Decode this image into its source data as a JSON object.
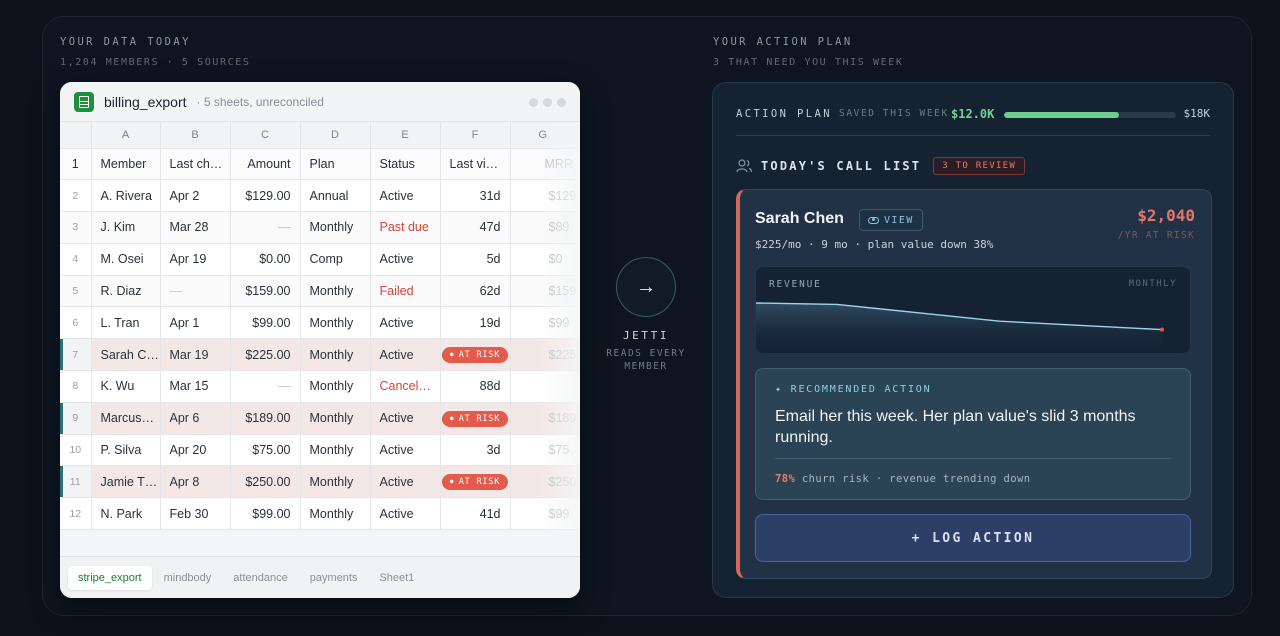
{
  "left_header": {
    "eyebrow": "YOUR DATA TODAY",
    "sub": "1,204 MEMBERS · 5 SOURCES"
  },
  "sheet": {
    "title": "billing_export",
    "subtitle": "· 5 sheets, unreconciled",
    "column_letters": [
      "A",
      "B",
      "C",
      "D",
      "E",
      "F",
      "G"
    ],
    "headers": [
      "Member",
      "Last ch…",
      "Amount",
      "Plan",
      "Status",
      "Last vi…",
      "MRR"
    ],
    "rows": [
      {
        "n": "2",
        "member": "A. Rivera",
        "last": "Apr 2",
        "amount": "$129.00",
        "plan": "Annual",
        "status": "Active",
        "visit": "31d",
        "mrr": "$129"
      },
      {
        "n": "3",
        "member": "J. Kim",
        "last": "Mar 28",
        "amount": "—",
        "plan": "Monthly",
        "status": "Past due",
        "visit": "47d",
        "mrr": "$89"
      },
      {
        "n": "4",
        "member": "M. Osei",
        "last": "Apr 19",
        "amount": "$0.00",
        "plan": "Comp",
        "status": "Active",
        "visit": "5d",
        "mrr": "$0"
      },
      {
        "n": "5",
        "member": "R. Diaz",
        "last": "—",
        "amount": "$159.00",
        "plan": "Monthly",
        "status": "Failed",
        "visit": "62d",
        "mrr": "$159"
      },
      {
        "n": "6",
        "member": "L. Tran",
        "last": "Apr 1",
        "amount": "$99.00",
        "plan": "Monthly",
        "status": "Active",
        "visit": "19d",
        "mrr": "$99"
      },
      {
        "n": "7",
        "member": "Sarah C…",
        "last": "Mar 19",
        "amount": "$225.00",
        "plan": "Monthly",
        "status": "Active",
        "visit": "AT RISK",
        "mrr": "$225"
      },
      {
        "n": "8",
        "member": "K. Wu",
        "last": "Mar 15",
        "amount": "—",
        "plan": "Monthly",
        "status": "Cancel…",
        "visit": "88d",
        "mrr": ""
      },
      {
        "n": "9",
        "member": "Marcus…",
        "last": "Apr 6",
        "amount": "$189.00",
        "plan": "Monthly",
        "status": "Active",
        "visit": "AT RISK",
        "mrr": "$189"
      },
      {
        "n": "10",
        "member": "P. Silva",
        "last": "Apr 20",
        "amount": "$75.00",
        "plan": "Monthly",
        "status": "Active",
        "visit": "3d",
        "mrr": "$75"
      },
      {
        "n": "11",
        "member": "Jamie T…",
        "last": "Apr 8",
        "amount": "$250.00",
        "plan": "Monthly",
        "status": "Active",
        "visit": "AT RISK",
        "mrr": "$250"
      },
      {
        "n": "12",
        "member": "N. Park",
        "last": "Feb 30",
        "amount": "$99.00",
        "plan": "Monthly",
        "status": "Active",
        "visit": "41d",
        "mrr": "$99"
      }
    ],
    "tabs": [
      "stripe_export",
      "mindbody",
      "attendance",
      "payments",
      "Sheet1"
    ]
  },
  "middle": {
    "arrow": "→",
    "name": "JETTI",
    "sub_line1": "READS EVERY",
    "sub_line2": "MEMBER"
  },
  "right_header": {
    "eyebrow": "YOUR ACTION PLAN",
    "sub": "3 THAT NEED YOU THIS WEEK"
  },
  "plan": {
    "label": "ACTION PLAN",
    "saved_label": "SAVED THIS WEEK",
    "saved_value": "$12.0K",
    "goal": "$18K",
    "progress_fraction": 0.667,
    "calls_title": "TODAY'S CALL LIST",
    "review_badge": "3 TO REVIEW",
    "card": {
      "name": "Sarah Chen",
      "view": "VIEW",
      "meta": "$225/mo · 9 mo · plan value down 38%",
      "risk_amount": "$2,040",
      "risk_label": "/YR AT RISK",
      "chart_label": "REVENUE",
      "chart_freq": "MONTHLY",
      "rec_label": "✦ RECOMMENDED ACTION",
      "rec_text": "Email her this week. Her plan value's slid 3 months running.",
      "churn_pct": "78%",
      "churn_text": "churn risk · revenue trending down",
      "log_action": "+ LOG ACTION"
    }
  },
  "chart_data": {
    "type": "area",
    "title": "",
    "xlabel": "",
    "ylabel": "REVENUE",
    "series": [
      {
        "values": [
          100,
          98,
          86,
          74,
          68,
          62
        ]
      }
    ]
  },
  "colors": {
    "accent_green": "#6fce8c",
    "risk_red": "#e25b4d",
    "button_blue": "#2d3f66"
  }
}
